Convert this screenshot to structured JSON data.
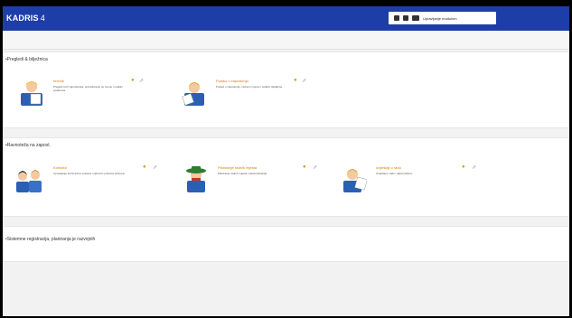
{
  "app": {
    "name": "KADRIS",
    "version": "4"
  },
  "toolbar": {
    "user_label": "Upravljanje modulom",
    "prev_label": "◄",
    "next_label": "►"
  },
  "sections": [
    {
      "title": "•Pregledi & bilježnica",
      "cards": [
        {
          "title": "Imenik",
          "desc": "Pregled svih zaposlenika, pretraživanje po imenu i ostalim podacima."
        },
        {
          "title": "Podaci o zaposlenju",
          "desc": "Podaci o zaposlenju, radnom mjestu i ostalim detaljima."
        }
      ]
    },
    {
      "title": "•Ravnoteža na zaposl.",
      "cards": [
        {
          "title": "Korisnici",
          "desc": "Upravljanje korisnicima sustava i njihovim pravima pristupa."
        },
        {
          "title": "Planiranje radnih mjesta",
          "desc": "Planiranje radnih mjesta i sistematizacija."
        },
        {
          "title": "Izvještaji o radu",
          "desc": "Izvještaji o radu i aktivnostima."
        }
      ]
    },
    {
      "title": "•Sistemne registracija, planiranja je razvojnih"
    }
  ]
}
